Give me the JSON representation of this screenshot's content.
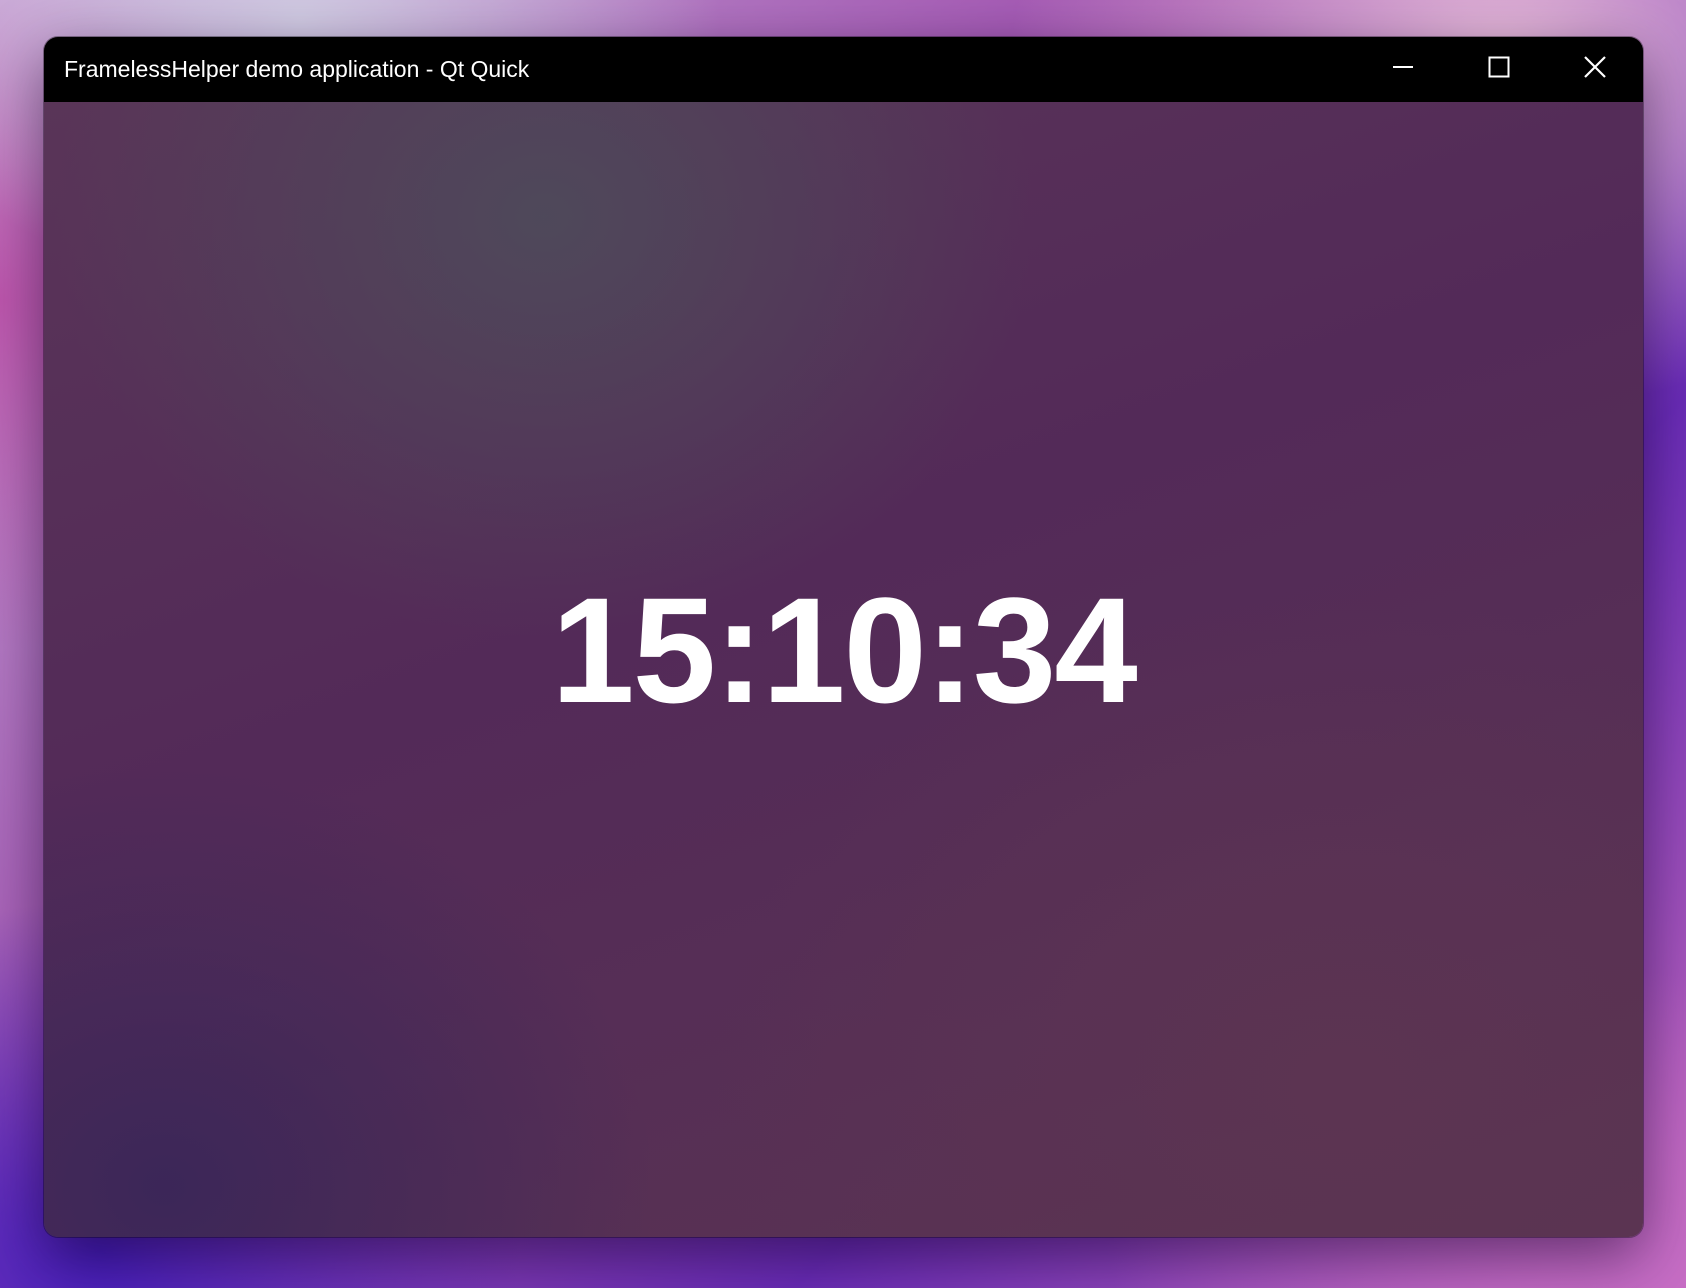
{
  "window": {
    "title": "FramelessHelper demo application - Qt Quick",
    "buttons": {
      "minimize_icon": "minimize-icon",
      "maximize_icon": "maximize-icon",
      "close_icon": "close-icon"
    }
  },
  "main": {
    "time": "15:10:34"
  },
  "colors": {
    "titlebar": "#000000",
    "text": "#ffffff",
    "background": "#532a58"
  }
}
